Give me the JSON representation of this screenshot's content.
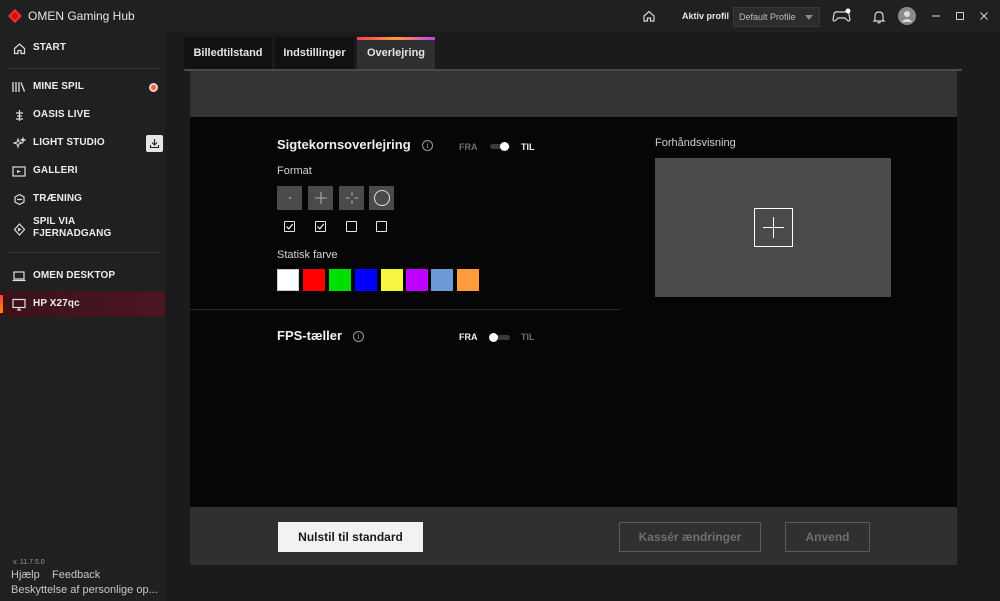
{
  "window": {
    "title": "OMEN Gaming Hub",
    "profile_label": "Aktiv profil",
    "profile_value": "Default Profile"
  },
  "sidebar": {
    "items": [
      {
        "label": "START",
        "icon": "home-icon"
      },
      {
        "label": "MINE SPIL",
        "icon": "library-icon"
      },
      {
        "label": "OASIS LIVE",
        "icon": "oasis-icon"
      },
      {
        "label": "LIGHT STUDIO",
        "icon": "sparkle-icon"
      },
      {
        "label": "GALLERI",
        "icon": "gallery-icon"
      },
      {
        "label": "TRÆNING",
        "icon": "training-icon"
      },
      {
        "label": "SPIL VIA\nFJERNADGANG",
        "line1": "SPIL VIA",
        "line2": "FJERNADGANG",
        "icon": "remote-play-icon"
      },
      {
        "label": "OMEN DESKTOP",
        "icon": "laptop-icon"
      },
      {
        "label": "HP X27qc",
        "icon": "monitor-icon"
      }
    ],
    "version": "v. 11.7.5.0",
    "help": "Hjælp",
    "feedback": "Feedback",
    "privacy": "Beskyttelse af personlige op..."
  },
  "tabs": [
    {
      "label": "Billedtilstand",
      "active": false
    },
    {
      "label": "Indstillinger",
      "active": false
    },
    {
      "label": "Overlejring",
      "active": true
    }
  ],
  "crosshair": {
    "title": "Sigtekornsoverlejring",
    "toggle_off": "FRA",
    "toggle_on": "TIL",
    "enabled": true,
    "format_label": "Format",
    "formats": [
      {
        "icon": "dot-crosshair-icon",
        "checked": true
      },
      {
        "icon": "plus-crosshair-icon",
        "checked": true
      },
      {
        "icon": "gap-crosshair-icon",
        "checked": false
      },
      {
        "icon": "circle-crosshair-icon",
        "checked": false
      }
    ],
    "color_label": "Statisk farve",
    "colors": [
      "#ffffff",
      "#ff0000",
      "#00e000",
      "#0000ff",
      "#f5f542",
      "#c000ff",
      "#6b9ad6",
      "#ff9a3d"
    ]
  },
  "preview": {
    "label": "Forhåndsvisning"
  },
  "fps": {
    "title": "FPS-tæller",
    "toggle_off": "FRA",
    "toggle_on": "TIL",
    "enabled": false
  },
  "actions": {
    "reset": "Nulstil til standard",
    "discard": "Kassér ændringer",
    "apply": "Anvend"
  },
  "colors": {
    "accent_red": "#ff3a5c",
    "accent_orange": "#ff9c32",
    "selected_nav_bg": "#4a1620"
  }
}
